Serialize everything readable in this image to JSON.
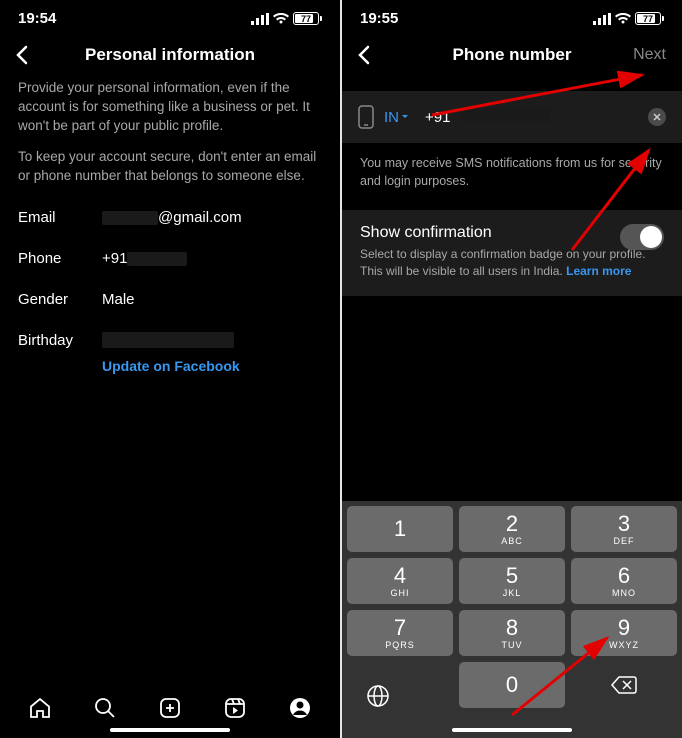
{
  "left": {
    "time": "19:54",
    "battery": "77",
    "title": "Personal information",
    "info1": "Provide your personal information, even if the account is for something like a business or pet. It won't be part of your public profile.",
    "info2": "To keep your account secure, don't enter an email or phone number that belongs to someone else.",
    "email_label": "Email",
    "email_value": "@gmail.com",
    "phone_label": "Phone",
    "phone_value": "+91",
    "gender_label": "Gender",
    "gender_value": "Male",
    "birthday_label": "Birthday",
    "fb_link": "Update on Facebook"
  },
  "right": {
    "time": "19:55",
    "battery": "77",
    "title": "Phone number",
    "next": "Next",
    "country": "IN",
    "prefix": "+91",
    "disclaimer": "You may receive SMS notifications from us for security and login purposes.",
    "confirm_title": "Show confirmation",
    "confirm_desc": "Select to display a confirmation badge on your profile. This will be visible to all users in India.",
    "learn": "Learn more",
    "keys": {
      "1": {
        "n": "1",
        "s": ""
      },
      "2": {
        "n": "2",
        "s": "ABC"
      },
      "3": {
        "n": "3",
        "s": "DEF"
      },
      "4": {
        "n": "4",
        "s": "GHI"
      },
      "5": {
        "n": "5",
        "s": "JKL"
      },
      "6": {
        "n": "6",
        "s": "MNO"
      },
      "7": {
        "n": "7",
        "s": "PQRS"
      },
      "8": {
        "n": "8",
        "s": "TUV"
      },
      "9": {
        "n": "9",
        "s": "WXYZ"
      },
      "0": {
        "n": "0",
        "s": ""
      }
    }
  }
}
